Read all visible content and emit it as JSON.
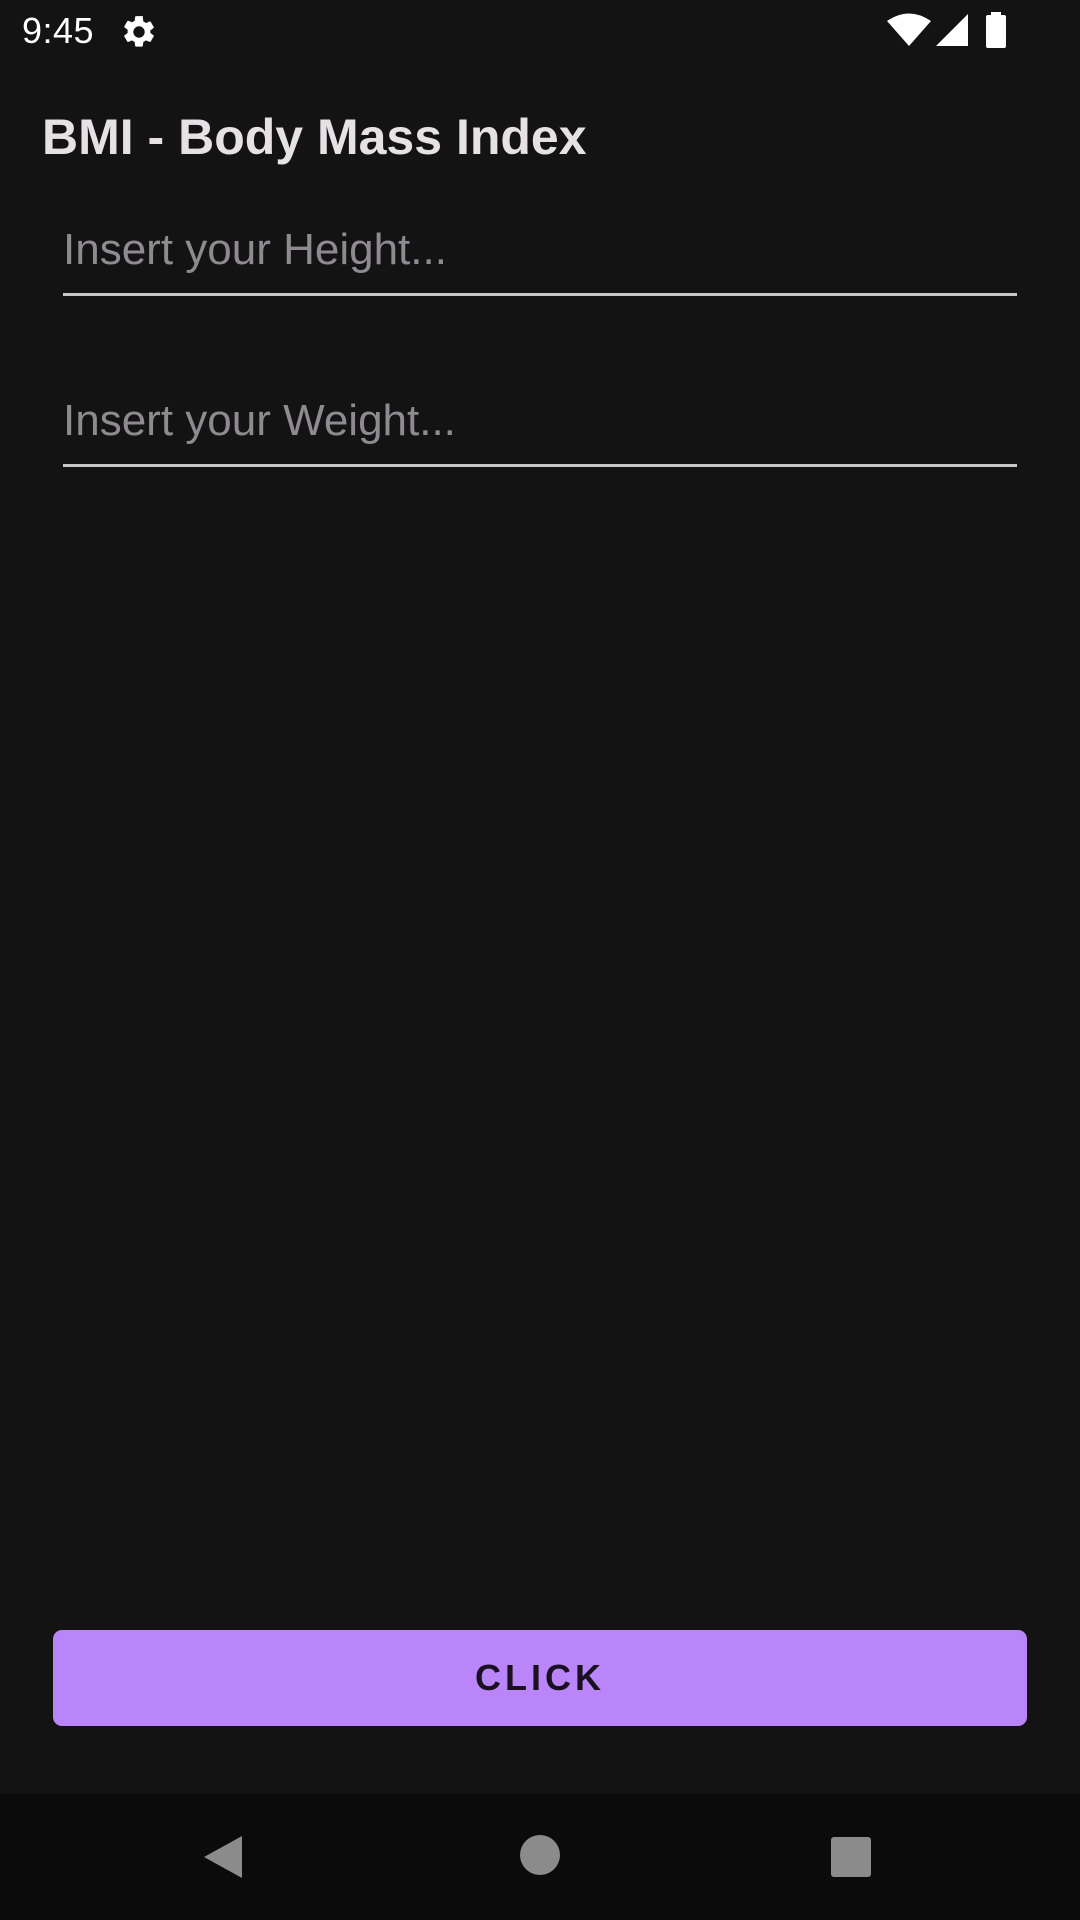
{
  "status_bar": {
    "time": "9:45",
    "icons": [
      "settings-icon",
      "wifi-icon",
      "signal-icon",
      "battery-icon"
    ]
  },
  "app": {
    "title": "BMI - Body Mass Index"
  },
  "form": {
    "height_field": {
      "placeholder": "Insert your Height...",
      "value": ""
    },
    "weight_field": {
      "placeholder": "Insert your Weight...",
      "value": ""
    }
  },
  "actions": {
    "click_label": "CLICK"
  },
  "navigation": {
    "icons": [
      "back-icon",
      "home-icon",
      "recents-icon"
    ]
  },
  "colors": {
    "background": "#131314",
    "accent": "#b985f8",
    "nav_background": "#0b0b0c"
  }
}
